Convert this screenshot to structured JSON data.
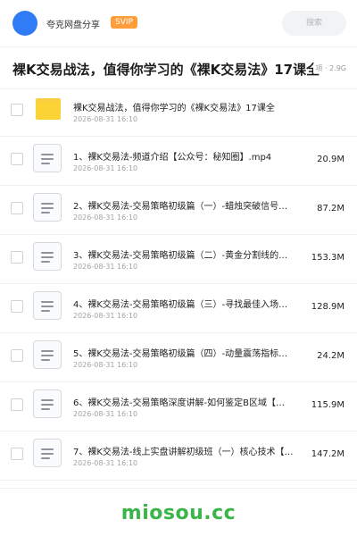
{
  "header": {
    "app_name": "夸克网盘分享",
    "badge": "SVIP",
    "search_placeholder": "搜索"
  },
  "share": {
    "title": "裸K交易战法，值得你学习的《裸K交易法》17课全",
    "meta": "项 · 2.9G"
  },
  "items": [
    {
      "type": "folder",
      "name": "裸K交易战法，值得你学习的《裸K交易法》17课全",
      "date": "2026-08-31 16:10",
      "size": ""
    },
    {
      "type": "file",
      "name": "1、裸K交易法-频道介绍【公众号：秘知圈】.mp4",
      "date": "2026-08-31 16:10",
      "size": "20.9M"
    },
    {
      "type": "file",
      "name": "2、裸K交易法-交易策略初级篇（一）-蜡烛突破信号…",
      "date": "2026-08-31 16:10",
      "size": "87.2M"
    },
    {
      "type": "file",
      "name": "3、裸K交易法-交易策略初级篇（二）-黄金分割线的…",
      "date": "2026-08-31 16:10",
      "size": "153.3M"
    },
    {
      "type": "file",
      "name": "4、裸K交易法-交易策略初级篇（三）-寻找最佳入场…",
      "date": "2026-08-31 16:10",
      "size": "128.9M"
    },
    {
      "type": "file",
      "name": "5、裸K交易法-交易策略初级篇（四）-动量震荡指标…",
      "date": "2026-08-31 16:10",
      "size": "24.2M"
    },
    {
      "type": "file",
      "name": "6、裸K交易法-交易策略深度讲解-如何鉴定B区域【…",
      "date": "2026-08-31 16:10",
      "size": "115.9M"
    },
    {
      "type": "file",
      "name": "7、裸K交易法-线上实盘讲解初级班（一）核心技术【…",
      "date": "2026-08-31 16:10",
      "size": "147.2M"
    }
  ],
  "watermark": "miosou.cc",
  "colors": {
    "accent": "#2f7cf6",
    "svip": "#ff9d3a",
    "folder": "#fcd335",
    "watermark": "#3bb44a"
  }
}
